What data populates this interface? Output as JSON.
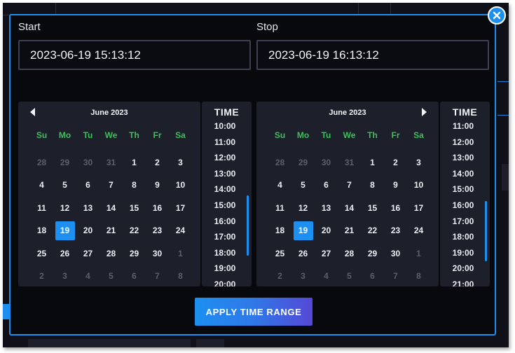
{
  "dialog": {
    "start_label": "Start",
    "stop_label": "Stop",
    "start_value": "2023-06-19 15:13:12",
    "stop_value": "2023-06-19 16:13:12",
    "apply_label": "APPLY TIME RANGE"
  },
  "calendars": [
    {
      "month": "June 2023",
      "weekdays": [
        "Su",
        "Mo",
        "Tu",
        "We",
        "Th",
        "Fr",
        "Sa"
      ],
      "days": [
        {
          "d": "28",
          "m": true
        },
        {
          "d": "29",
          "m": true
        },
        {
          "d": "30",
          "m": true
        },
        {
          "d": "31",
          "m": true
        },
        {
          "d": "1"
        },
        {
          "d": "2"
        },
        {
          "d": "3"
        },
        {
          "d": "4"
        },
        {
          "d": "5"
        },
        {
          "d": "6"
        },
        {
          "d": "7"
        },
        {
          "d": "8"
        },
        {
          "d": "9"
        },
        {
          "d": "10"
        },
        {
          "d": "11"
        },
        {
          "d": "12"
        },
        {
          "d": "13"
        },
        {
          "d": "14"
        },
        {
          "d": "15"
        },
        {
          "d": "16"
        },
        {
          "d": "17"
        },
        {
          "d": "18"
        },
        {
          "d": "19",
          "s": true
        },
        {
          "d": "20"
        },
        {
          "d": "21"
        },
        {
          "d": "22"
        },
        {
          "d": "23"
        },
        {
          "d": "24"
        },
        {
          "d": "25"
        },
        {
          "d": "26"
        },
        {
          "d": "27"
        },
        {
          "d": "28"
        },
        {
          "d": "29"
        },
        {
          "d": "30"
        },
        {
          "d": "1",
          "m": true
        },
        {
          "d": "2",
          "m": true
        },
        {
          "d": "3",
          "m": true
        },
        {
          "d": "4",
          "m": true
        },
        {
          "d": "5",
          "m": true
        },
        {
          "d": "6",
          "m": true
        },
        {
          "d": "7",
          "m": true
        },
        {
          "d": "8",
          "m": true
        }
      ],
      "time_title": "TIME",
      "times": [
        "10:00",
        "11:00",
        "12:00",
        "13:00",
        "14:00",
        "15:00",
        "16:00",
        "17:00",
        "18:00",
        "19:00",
        "20:00"
      ]
    },
    {
      "month": "June 2023",
      "weekdays": [
        "Su",
        "Mo",
        "Tu",
        "We",
        "Th",
        "Fr",
        "Sa"
      ],
      "days": [
        {
          "d": "28",
          "m": true
        },
        {
          "d": "29",
          "m": true
        },
        {
          "d": "30",
          "m": true
        },
        {
          "d": "31",
          "m": true
        },
        {
          "d": "1"
        },
        {
          "d": "2"
        },
        {
          "d": "3"
        },
        {
          "d": "4"
        },
        {
          "d": "5"
        },
        {
          "d": "6"
        },
        {
          "d": "7"
        },
        {
          "d": "8"
        },
        {
          "d": "9"
        },
        {
          "d": "10"
        },
        {
          "d": "11"
        },
        {
          "d": "12"
        },
        {
          "d": "13"
        },
        {
          "d": "14"
        },
        {
          "d": "15"
        },
        {
          "d": "16"
        },
        {
          "d": "17"
        },
        {
          "d": "18"
        },
        {
          "d": "19",
          "s": true
        },
        {
          "d": "20"
        },
        {
          "d": "21"
        },
        {
          "d": "22"
        },
        {
          "d": "23"
        },
        {
          "d": "24"
        },
        {
          "d": "25"
        },
        {
          "d": "26"
        },
        {
          "d": "27"
        },
        {
          "d": "28"
        },
        {
          "d": "29"
        },
        {
          "d": "30"
        },
        {
          "d": "1",
          "m": true
        },
        {
          "d": "2",
          "m": true
        },
        {
          "d": "3",
          "m": true
        },
        {
          "d": "4",
          "m": true
        },
        {
          "d": "5",
          "m": true
        },
        {
          "d": "6",
          "m": true
        },
        {
          "d": "7",
          "m": true
        },
        {
          "d": "8",
          "m": true
        }
      ],
      "time_title": "TIME",
      "times": [
        "11:00",
        "12:00",
        "13:00",
        "14:00",
        "15:00",
        "16:00",
        "17:00",
        "18:00",
        "19:00",
        "20:00",
        "21:00"
      ]
    }
  ],
  "colors": {
    "accent": "#1d8ff0",
    "weekday": "#3fbf5a",
    "muted_day": "#5a5f6e",
    "panel": "#1d1f2b",
    "modal_bg": "#08090d"
  },
  "icons": {
    "close": "close-icon",
    "prev": "chevron-left-icon",
    "next": "chevron-right-icon"
  }
}
